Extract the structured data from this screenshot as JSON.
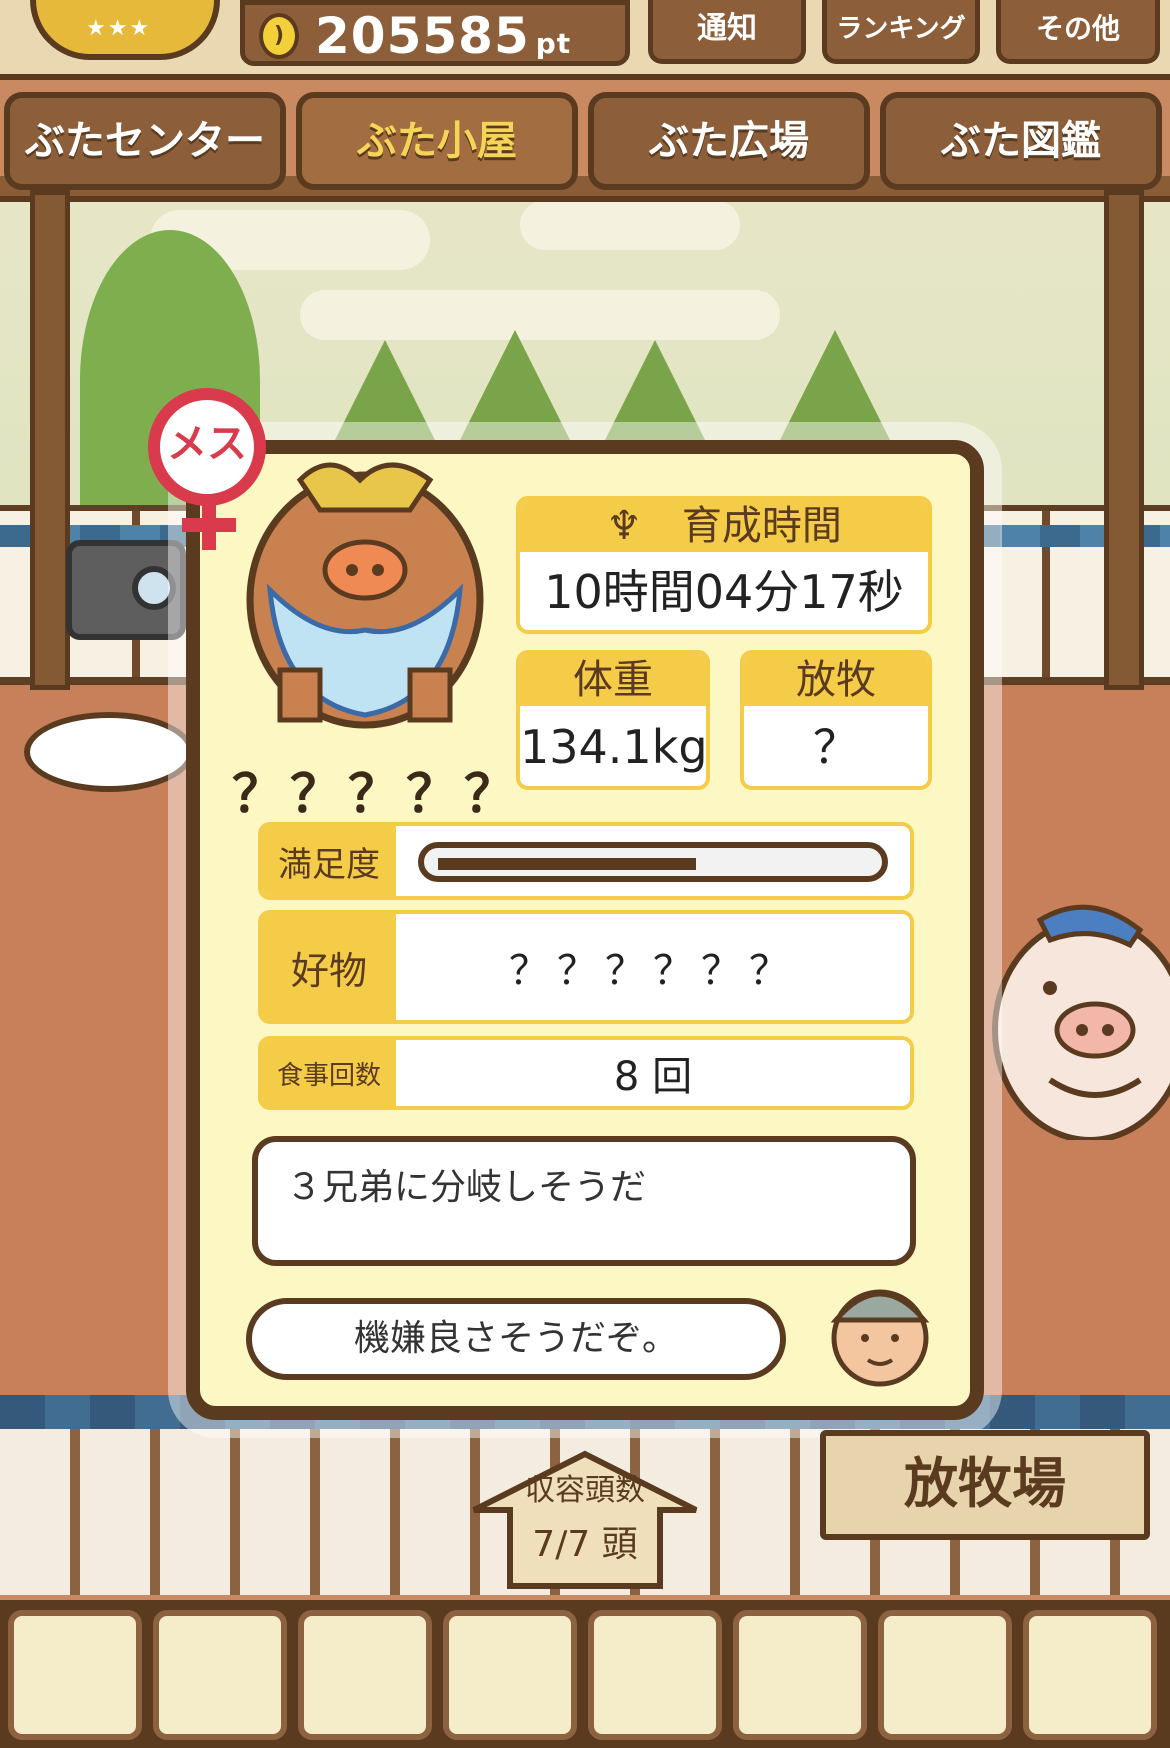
{
  "header": {
    "points_value": "205585",
    "points_unit": "pt",
    "buttons": [
      "通知",
      "ランキング",
      "その他"
    ]
  },
  "tabs": [
    {
      "label": "ぶたセンター",
      "active": false
    },
    {
      "label": "ぶた小屋",
      "active": true
    },
    {
      "label": "ぶた広場",
      "active": false
    },
    {
      "label": "ぶた図鑑",
      "active": false
    }
  ],
  "pig": {
    "gender_label": "メス",
    "name": "？？？？？"
  },
  "panel": {
    "growth_time_label": "育成時間",
    "growth_time_value": "10時間04分17秒",
    "weight_label": "体重",
    "weight_value": "134.1kg",
    "grazing_label": "放牧",
    "grazing_value": "？",
    "satisfaction_label": "満足度",
    "satisfaction_fraction": 0.6,
    "favorite_label": "好物",
    "favorite_value": "？？？？？？",
    "meals_label": "食事回数",
    "meals_value": "8 回",
    "hint_text": "３兄弟に分岐しそうだ",
    "mood_text": "機嫌良さそうだぞ。"
  },
  "capacity": {
    "label": "収容頭数",
    "value": "7/7 頭"
  },
  "pasture_sign": "放牧場",
  "foods": [
    "grain-pile-icon",
    "mixed-grain-icon",
    "sweet-potato-icon",
    "corn-icon",
    "vegetables-icon",
    "acorn-icon",
    "grain-plate-icon",
    "truffle-plate-icon"
  ],
  "colors": {
    "accent_yellow": "#f4cc48",
    "wood_dark": "#5a3b20",
    "panel_bg": "#fdf7c3",
    "gender_red": "#d93a4c"
  }
}
